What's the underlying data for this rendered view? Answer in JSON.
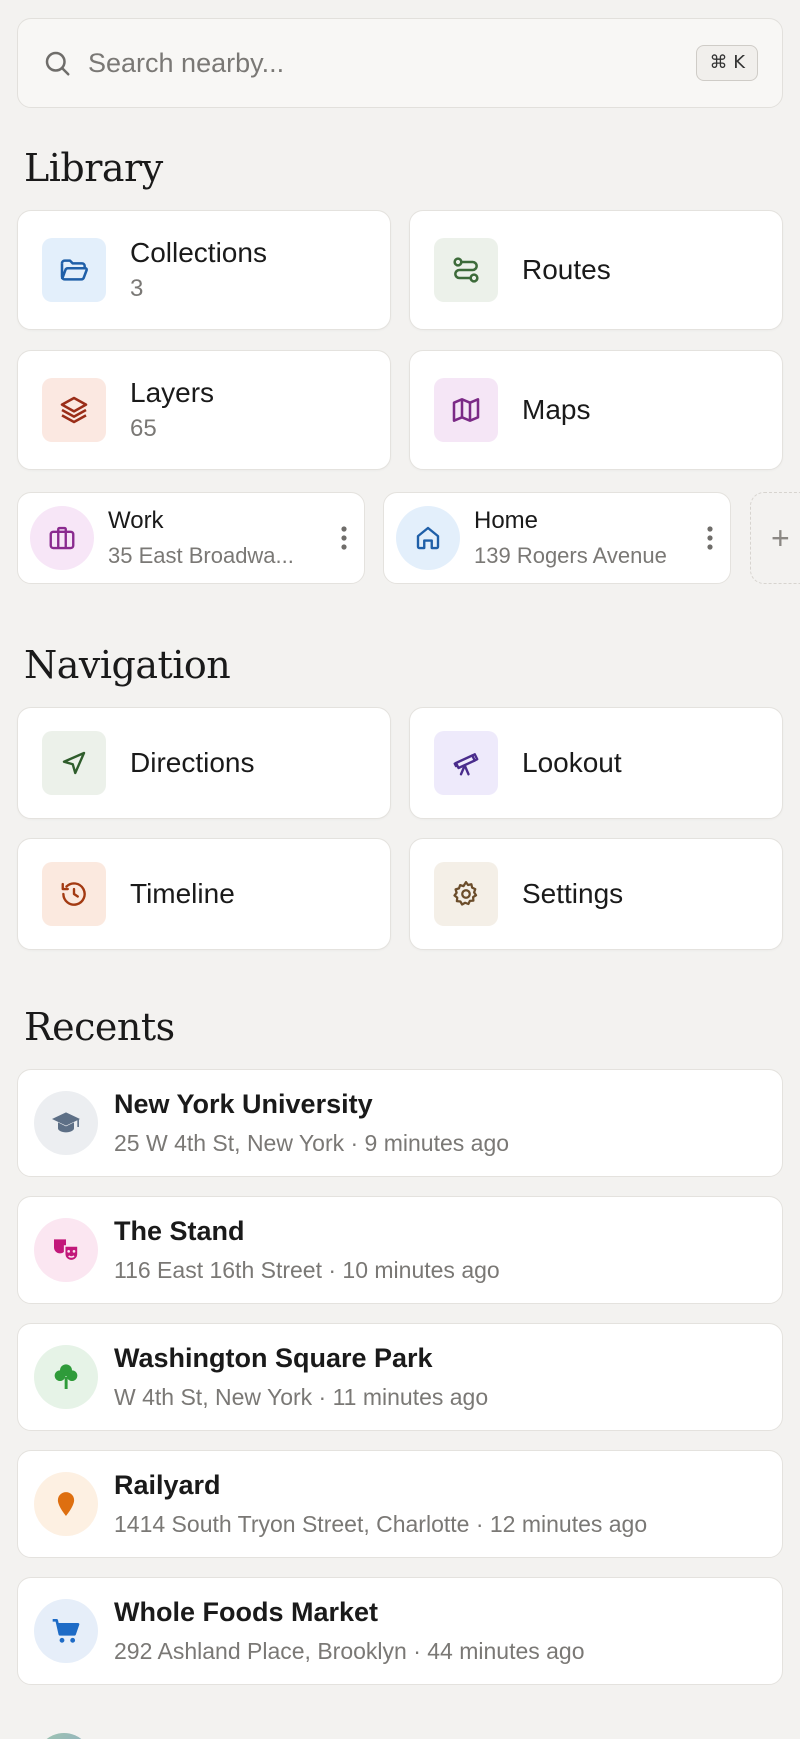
{
  "search": {
    "placeholder": "Search nearby...",
    "shortcut": "⌘ K"
  },
  "library": {
    "title": "Library",
    "tiles": [
      {
        "label": "Collections",
        "count": "3",
        "icon": "folder-open-icon",
        "color": "#1f5fa8",
        "bg": "#e3effb"
      },
      {
        "label": "Routes",
        "count": "",
        "icon": "route-icon",
        "color": "#3d6b3a",
        "bg": "#ecf1ea"
      },
      {
        "label": "Layers",
        "count": "65",
        "icon": "layers-icon",
        "color": "#9a2d18",
        "bg": "#fbe8e1"
      },
      {
        "label": "Maps",
        "count": "",
        "icon": "map-icon",
        "color": "#7b2a86",
        "bg": "#f5e6f6"
      }
    ],
    "places": [
      {
        "name": "Work",
        "address": "35 East Broadwa...",
        "icon": "briefcase-icon",
        "color": "#8a2a8f",
        "bg": "#f7e6f7"
      },
      {
        "name": "Home",
        "address": "139 Rogers Avenue",
        "icon": "home-icon",
        "color": "#1f5fa8",
        "bg": "#e3effb"
      }
    ],
    "add_label": "+"
  },
  "navigation": {
    "title": "Navigation",
    "tiles": [
      {
        "label": "Directions",
        "icon": "navigation-arrow-icon",
        "color": "#2f5d2c",
        "bg": "#ecf1ea"
      },
      {
        "label": "Lookout",
        "icon": "telescope-icon",
        "color": "#4a2c8c",
        "bg": "#eeeafb"
      },
      {
        "label": "Timeline",
        "icon": "history-icon",
        "color": "#a33a12",
        "bg": "#fbe9df"
      },
      {
        "label": "Settings",
        "icon": "gear-icon",
        "color": "#6b4d2b",
        "bg": "#f4efe7"
      }
    ]
  },
  "recents": {
    "title": "Recents",
    "items": [
      {
        "name": "New York University",
        "detail": "25 W 4th St, New York · 9 minutes ago",
        "icon": "graduation-cap-icon",
        "color": "#5d6f86",
        "bg": "#eceef1"
      },
      {
        "name": "The Stand",
        "detail": "116 East 16th Street · 10 minutes ago",
        "icon": "theater-masks-icon",
        "color": "#c2187a",
        "bg": "#fbe6f1"
      },
      {
        "name": "Washington Square Park",
        "detail": "W 4th St, New York · 11 minutes ago",
        "icon": "tree-icon",
        "color": "#2f9b3a",
        "bg": "#e6f3e7"
      },
      {
        "name": "Railyard",
        "detail": "1414 South Tryon Street, Charlotte · 12 minutes ago",
        "icon": "map-pin-icon",
        "color": "#de6f10",
        "bg": "#fdf0e2"
      },
      {
        "name": "Whole Foods Market",
        "detail": "292 Ashland Place, Brooklyn · 44 minutes ago",
        "icon": "shopping-cart-icon",
        "color": "#1e6bc6",
        "bg": "#e6eef9"
      }
    ]
  }
}
